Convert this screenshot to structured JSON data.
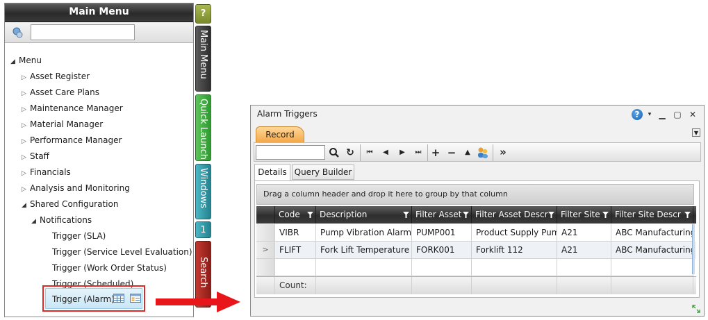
{
  "menu": {
    "title": "Main Menu",
    "search_placeholder": "",
    "tree": {
      "root": "Menu",
      "items": [
        "Asset Register",
        "Asset Care Plans",
        "Maintenance Manager",
        "Material Manager",
        "Performance Manager",
        "Staff",
        "Financials",
        "Analysis and Monitoring",
        "Shared Configuration"
      ],
      "notifications": "Notifications",
      "leaves": [
        "Trigger (SLA)",
        "Trigger (Service Level Evaluation)",
        "Trigger (Work Order Status)",
        "Trigger (Scheduled)",
        "Trigger (Alarm)"
      ]
    }
  },
  "side_tabs": {
    "help": "?",
    "main_menu": "Main Menu",
    "quick_launch": "Quick Launch",
    "windows": "Windows",
    "window_count": "1",
    "search": "Search",
    "colors": {
      "help": "#8a9a3c",
      "main_menu": "#3a3a3a",
      "quick_launch": "#3fae3f",
      "windows": "#2f9aa8",
      "window_count": "#2f9aa8",
      "search": "#a8261f"
    }
  },
  "window": {
    "title": "Alarm Triggers",
    "record_tab": "Record",
    "toolbar": {
      "search_value": "",
      "search_icon": "magnifier-icon",
      "refresh_icon": "refresh-icon",
      "first": "⏮",
      "prev": "◀",
      "next": "▶",
      "last": "⏭",
      "add": "+",
      "remove": "−",
      "up": "▲",
      "more": "»"
    },
    "subtabs": [
      "Details",
      "Query Builder"
    ],
    "group_hint": "Drag a column header and drop it here to group by that column",
    "columns": [
      "Code",
      "Description",
      "Filter Asset",
      "Filter Asset Descr",
      "Filter Site",
      "Filter Site Descr"
    ],
    "rows": [
      {
        "indicator": "",
        "cells": [
          "VIBR",
          "Pump Vibration Alarm",
          "PUMP001",
          "Product Supply Pum",
          "A21",
          "ABC Manufacturing"
        ]
      },
      {
        "indicator": ">",
        "cells": [
          "FLIFT",
          "Fork Lift Temperature",
          "FORK001",
          "Forklift 112",
          "A21",
          "ABC Manufacturing"
        ]
      }
    ],
    "footer": {
      "count_label": "Count:"
    }
  },
  "accent_colors": {
    "record_tab": "#f3a646",
    "highlight": "#d92b2b",
    "arrow": "#e8151b"
  }
}
